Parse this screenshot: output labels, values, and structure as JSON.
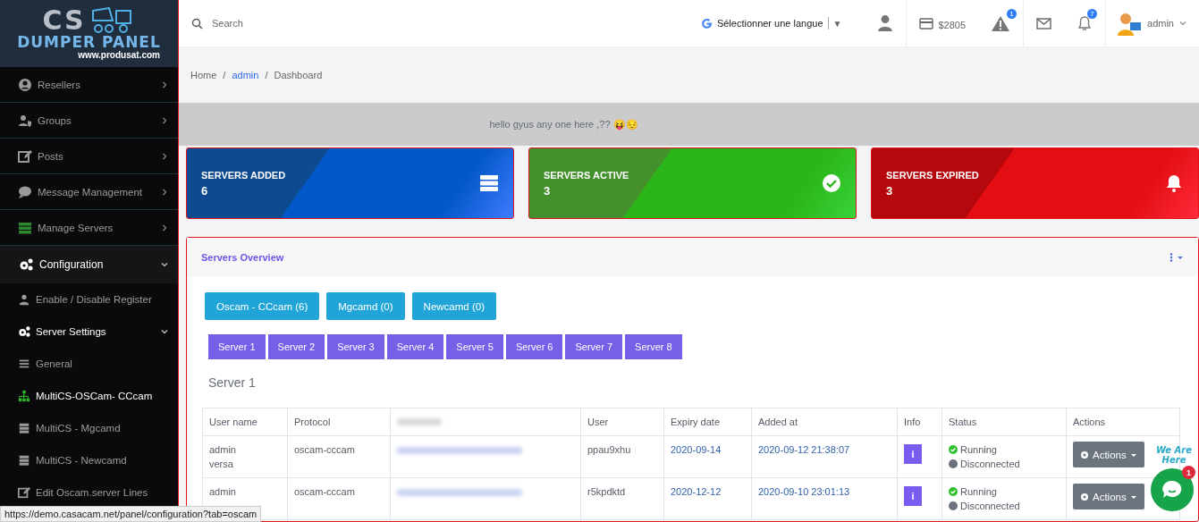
{
  "logo": {
    "mark": "CS",
    "title": "DUMPER PANEL",
    "url": "www.produsat.com"
  },
  "sidebar": {
    "items": [
      {
        "label": "Resellers",
        "kind": "item",
        "expanded": false
      },
      {
        "label": "Groups",
        "kind": "item",
        "expanded": false
      },
      {
        "label": "Posts",
        "kind": "item",
        "expanded": false
      },
      {
        "label": "Message Management",
        "kind": "item",
        "expanded": false
      },
      {
        "label": "Manage Servers",
        "kind": "item",
        "expanded": false
      },
      {
        "label": "Configuration",
        "kind": "item",
        "expanded": true
      },
      {
        "label": "Enable / Disable Register",
        "kind": "sub",
        "selected": false
      },
      {
        "label": "Server Settings",
        "kind": "group",
        "expanded": true
      },
      {
        "label": "General",
        "kind": "sub",
        "selected": false
      },
      {
        "label": "MultiCS-OSCam- CCcam",
        "kind": "sub",
        "selected": true
      },
      {
        "label": "MultiCS - Mgcamd",
        "kind": "sub",
        "selected": false
      },
      {
        "label": "MultiCS - Newcamd",
        "kind": "sub",
        "selected": false
      },
      {
        "label": "Edit Oscam.server Lines",
        "kind": "sub",
        "selected": false
      }
    ]
  },
  "topbar": {
    "search": {
      "placeholder": "Search"
    },
    "language": "Sélectionner une langue",
    "language_caret": "▼",
    "balance": "$2805",
    "alert_badge": "1",
    "notification_badge": "7",
    "user": "admin"
  },
  "breadcrumb": {
    "items": [
      "Home",
      "admin",
      "Dashboard"
    ],
    "separator": "/"
  },
  "message": "hello gyus any one here ,?? 😝😔",
  "cards": [
    {
      "kind": "added",
      "title": "SERVERS ADDED",
      "value": "6"
    },
    {
      "kind": "active",
      "title": "SERVERS ACTIVE",
      "value": "3"
    },
    {
      "kind": "expired",
      "title": "SERVERS EXPIRED",
      "value": "3"
    }
  ],
  "panel": {
    "title": "Servers Overview",
    "protocol_tabs": [
      "Oscam - CCcam (6)",
      "Mgcamd (0)",
      "Newcamd (0)"
    ],
    "server_tabs": [
      "Server 1",
      "Server 2",
      "Server 3",
      "Server 4",
      "Server 5",
      "Server 6",
      "Server 7",
      "Server 8"
    ],
    "heading": "Server 1",
    "table": {
      "columns": [
        "User name",
        "Protocol",
        "User",
        "Expiry date",
        "Added at",
        "Info",
        "Status",
        "Actions"
      ],
      "rows": [
        {
          "user_name": [
            "admin",
            "versa"
          ],
          "protocol": "oscam-cccam",
          "user": "ppau9xhu",
          "expiry": "2020-09-14",
          "added": "2020-09-12 21:38:07",
          "info": "i",
          "status": [
            {
              "label": "Running",
              "kind": "ok"
            },
            {
              "label": "Disconnected",
              "kind": "off"
            }
          ],
          "action": "Actions"
        },
        {
          "user_name": [
            "admin"
          ],
          "protocol": "oscam-cccam",
          "user": "r5kpdktd",
          "expiry": "2020-12-12",
          "added": "2020-09-10 23:01:13",
          "info": "i",
          "status": [
            {
              "label": "Running",
              "kind": "ok"
            },
            {
              "label": "Disconnected",
              "kind": "off"
            }
          ],
          "action": "Actions"
        }
      ]
    }
  },
  "status_url": "https://demo.casacam.net/panel/configuration?tab=oscam",
  "chat": {
    "caption": "We Are Here",
    "badge": "1"
  }
}
